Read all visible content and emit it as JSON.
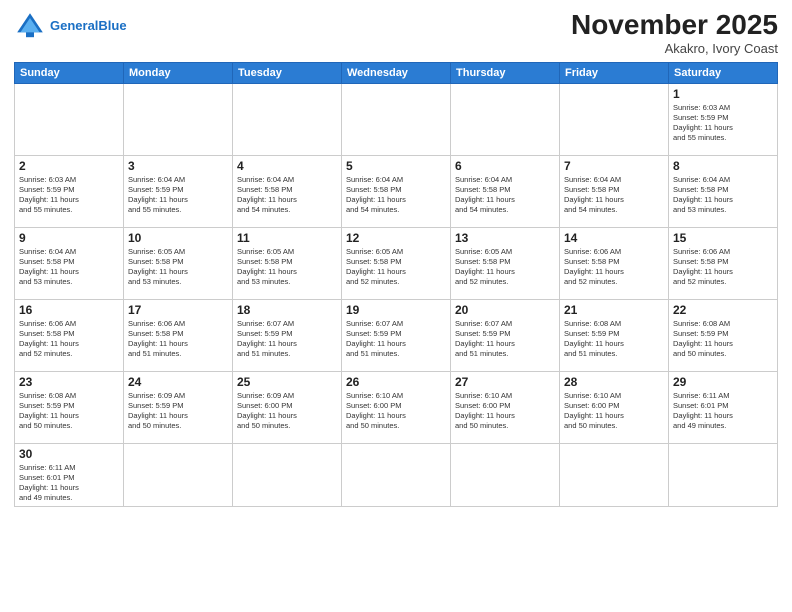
{
  "header": {
    "logo_general": "General",
    "logo_blue": "Blue",
    "month_title": "November 2025",
    "subtitle": "Akakro, Ivory Coast"
  },
  "days_of_week": [
    "Sunday",
    "Monday",
    "Tuesday",
    "Wednesday",
    "Thursday",
    "Friday",
    "Saturday"
  ],
  "weeks": [
    [
      {
        "day": "",
        "info": ""
      },
      {
        "day": "",
        "info": ""
      },
      {
        "day": "",
        "info": ""
      },
      {
        "day": "",
        "info": ""
      },
      {
        "day": "",
        "info": ""
      },
      {
        "day": "",
        "info": ""
      },
      {
        "day": "1",
        "info": "Sunrise: 6:03 AM\nSunset: 5:59 PM\nDaylight: 11 hours\nand 55 minutes."
      }
    ],
    [
      {
        "day": "2",
        "info": "Sunrise: 6:03 AM\nSunset: 5:59 PM\nDaylight: 11 hours\nand 55 minutes."
      },
      {
        "day": "3",
        "info": "Sunrise: 6:04 AM\nSunset: 5:59 PM\nDaylight: 11 hours\nand 55 minutes."
      },
      {
        "day": "4",
        "info": "Sunrise: 6:04 AM\nSunset: 5:58 PM\nDaylight: 11 hours\nand 54 minutes."
      },
      {
        "day": "5",
        "info": "Sunrise: 6:04 AM\nSunset: 5:58 PM\nDaylight: 11 hours\nand 54 minutes."
      },
      {
        "day": "6",
        "info": "Sunrise: 6:04 AM\nSunset: 5:58 PM\nDaylight: 11 hours\nand 54 minutes."
      },
      {
        "day": "7",
        "info": "Sunrise: 6:04 AM\nSunset: 5:58 PM\nDaylight: 11 hours\nand 54 minutes."
      },
      {
        "day": "8",
        "info": "Sunrise: 6:04 AM\nSunset: 5:58 PM\nDaylight: 11 hours\nand 53 minutes."
      }
    ],
    [
      {
        "day": "9",
        "info": "Sunrise: 6:04 AM\nSunset: 5:58 PM\nDaylight: 11 hours\nand 53 minutes."
      },
      {
        "day": "10",
        "info": "Sunrise: 6:05 AM\nSunset: 5:58 PM\nDaylight: 11 hours\nand 53 minutes."
      },
      {
        "day": "11",
        "info": "Sunrise: 6:05 AM\nSunset: 5:58 PM\nDaylight: 11 hours\nand 53 minutes."
      },
      {
        "day": "12",
        "info": "Sunrise: 6:05 AM\nSunset: 5:58 PM\nDaylight: 11 hours\nand 52 minutes."
      },
      {
        "day": "13",
        "info": "Sunrise: 6:05 AM\nSunset: 5:58 PM\nDaylight: 11 hours\nand 52 minutes."
      },
      {
        "day": "14",
        "info": "Sunrise: 6:06 AM\nSunset: 5:58 PM\nDaylight: 11 hours\nand 52 minutes."
      },
      {
        "day": "15",
        "info": "Sunrise: 6:06 AM\nSunset: 5:58 PM\nDaylight: 11 hours\nand 52 minutes."
      }
    ],
    [
      {
        "day": "16",
        "info": "Sunrise: 6:06 AM\nSunset: 5:58 PM\nDaylight: 11 hours\nand 52 minutes."
      },
      {
        "day": "17",
        "info": "Sunrise: 6:06 AM\nSunset: 5:58 PM\nDaylight: 11 hours\nand 51 minutes."
      },
      {
        "day": "18",
        "info": "Sunrise: 6:07 AM\nSunset: 5:59 PM\nDaylight: 11 hours\nand 51 minutes."
      },
      {
        "day": "19",
        "info": "Sunrise: 6:07 AM\nSunset: 5:59 PM\nDaylight: 11 hours\nand 51 minutes."
      },
      {
        "day": "20",
        "info": "Sunrise: 6:07 AM\nSunset: 5:59 PM\nDaylight: 11 hours\nand 51 minutes."
      },
      {
        "day": "21",
        "info": "Sunrise: 6:08 AM\nSunset: 5:59 PM\nDaylight: 11 hours\nand 51 minutes."
      },
      {
        "day": "22",
        "info": "Sunrise: 6:08 AM\nSunset: 5:59 PM\nDaylight: 11 hours\nand 50 minutes."
      }
    ],
    [
      {
        "day": "23",
        "info": "Sunrise: 6:08 AM\nSunset: 5:59 PM\nDaylight: 11 hours\nand 50 minutes."
      },
      {
        "day": "24",
        "info": "Sunrise: 6:09 AM\nSunset: 5:59 PM\nDaylight: 11 hours\nand 50 minutes."
      },
      {
        "day": "25",
        "info": "Sunrise: 6:09 AM\nSunset: 6:00 PM\nDaylight: 11 hours\nand 50 minutes."
      },
      {
        "day": "26",
        "info": "Sunrise: 6:10 AM\nSunset: 6:00 PM\nDaylight: 11 hours\nand 50 minutes."
      },
      {
        "day": "27",
        "info": "Sunrise: 6:10 AM\nSunset: 6:00 PM\nDaylight: 11 hours\nand 50 minutes."
      },
      {
        "day": "28",
        "info": "Sunrise: 6:10 AM\nSunset: 6:00 PM\nDaylight: 11 hours\nand 50 minutes."
      },
      {
        "day": "29",
        "info": "Sunrise: 6:11 AM\nSunset: 6:01 PM\nDaylight: 11 hours\nand 49 minutes."
      }
    ],
    [
      {
        "day": "30",
        "info": "Sunrise: 6:11 AM\nSunset: 6:01 PM\nDaylight: 11 hours\nand 49 minutes."
      },
      {
        "day": "",
        "info": ""
      },
      {
        "day": "",
        "info": ""
      },
      {
        "day": "",
        "info": ""
      },
      {
        "day": "",
        "info": ""
      },
      {
        "day": "",
        "info": ""
      },
      {
        "day": "",
        "info": ""
      }
    ]
  ]
}
